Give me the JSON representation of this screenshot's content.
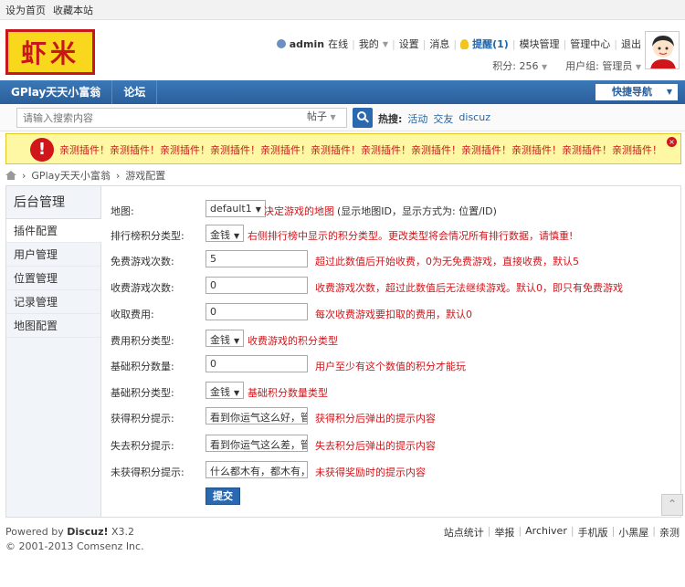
{
  "topbar": {
    "set_home": "设为首页",
    "bookmark": "收藏本站"
  },
  "logo": {
    "text": "虾米"
  },
  "user": {
    "name": "admin",
    "status": "在线",
    "mine": "我的",
    "settings": "设置",
    "messages": "消息",
    "remind": "提醒(1)",
    "plugin_admin": "模块管理",
    "admin_center": "管理中心",
    "logout": "退出",
    "credits": "积分: 256",
    "usergroup": "用户组: 管理员"
  },
  "nav": {
    "items": [
      "GPlay天天小富翁",
      "论坛"
    ],
    "quick_nav": "快捷导航"
  },
  "search": {
    "placeholder": "请输入搜索内容",
    "type": "帖子",
    "hot_label": "热搜:",
    "hot_words": [
      "活动",
      "交友",
      "discuz"
    ]
  },
  "warning": {
    "text": "亲测插件！亲测插件！亲测插件！亲测插件！亲测插件！亲测插件！亲测插件！亲测插件！亲测插件！亲测插件！亲测插件！亲测插件！亲测插件！",
    "close": "×"
  },
  "breadcrumb": {
    "items": [
      "GPlay天天小富翁",
      "游戏配置"
    ]
  },
  "sidebar": {
    "title": "后台管理",
    "items": [
      "插件配置",
      "用户管理",
      "位置管理",
      "记录管理",
      "地图配置"
    ]
  },
  "form": {
    "rows": [
      {
        "label": "地图:",
        "select": "default1",
        "desc": "决定游戏的地图",
        "desc2": "(显示地图ID，显示方式为: 位置/ID)"
      },
      {
        "label": "排行榜积分类型:",
        "select": "金钱",
        "desc": "右侧排行榜中显示的积分类型。更改类型将会情况所有排行数据，请慎重!"
      },
      {
        "label": "免费游戏次数:",
        "value": "5",
        "desc": "超过此数值后开始收费，0为无免费游戏，直接收费，默认5"
      },
      {
        "label": "收费游戏次数:",
        "value": "0",
        "desc": "收费游戏次数，超过此数值后无法继续游戏。默认0，即只有免费游戏"
      },
      {
        "label": "收取费用:",
        "value": "0",
        "desc": "每次收费游戏要扣取的费用，默认0"
      },
      {
        "label": "费用积分类型:",
        "select": "金钱",
        "desc": "收费游戏的积分类型"
      },
      {
        "label": "基础积分数量:",
        "value": "0",
        "desc": "用户至少有这个数值的积分才能玩"
      },
      {
        "label": "基础积分类型:",
        "select": "金钱",
        "desc": "基础积分数量类型"
      },
      {
        "label": "获得积分提示:",
        "value": "看到你运气这么好，管理员",
        "desc": "获得积分后弹出的提示内容"
      },
      {
        "label": "失去积分提示:",
        "value": "看到你运气这么差，管理员",
        "desc": "失去积分后弹出的提示内容"
      },
      {
        "label": "未获得积分提示:",
        "value": "什么都木有，都木有，都木",
        "desc": "未获得奖励时的提示内容"
      }
    ],
    "submit": "提交"
  },
  "footer": {
    "powered": "Powered by",
    "product": "Discuz!",
    "version": "X3.2",
    "copyright": "© 2001-2013 Comsenz Inc.",
    "links": [
      "站点统计",
      "举报",
      "Archiver",
      "手机版",
      "小黑屋",
      "亲测"
    ]
  },
  "colors": {
    "nav_blue": "#2a5f9a",
    "warn_red": "#d0161b",
    "warn_bg": "#fef8a4"
  }
}
